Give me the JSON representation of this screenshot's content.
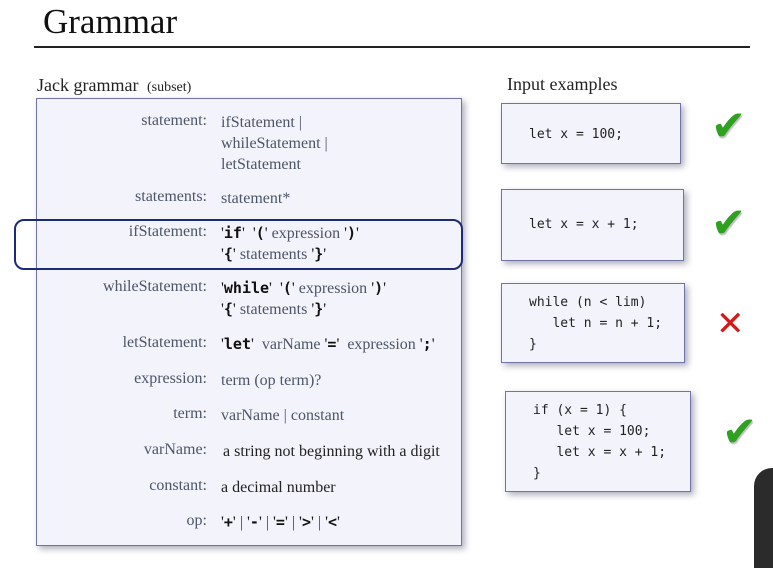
{
  "title": "Grammar",
  "grammar": {
    "heading": "Jack grammar",
    "heading_sub": "(subset)",
    "rules": [
      {
        "label": "statement:",
        "lines": [
          "ifStatement |",
          "whileStatement |",
          "letStatement"
        ]
      },
      {
        "label": "statements:",
        "text": "statement*"
      },
      {
        "label": "ifStatement:",
        "kw_if": "if",
        "open_paren": "(",
        "expression": "expression",
        "close_paren": ")",
        "open_brace": "{",
        "statements": "statements",
        "close_brace": "}"
      },
      {
        "label": "whileStatement:",
        "kw_while": "while",
        "open_paren": "(",
        "expression": "expression",
        "close_paren": ")",
        "open_brace": "{",
        "statements": "statements",
        "close_brace": "}"
      },
      {
        "label": "letStatement:",
        "kw_let": "let",
        "varname": "varName",
        "eq": "=",
        "expression": "expression",
        "semi": ";"
      },
      {
        "label": "expression:",
        "text": "term (op term)?"
      },
      {
        "label": "term:",
        "text": "varName | constant"
      },
      {
        "label": "varName:",
        "text": "a string not beginning with a digit"
      },
      {
        "label": "constant:",
        "text": "a decimal number"
      },
      {
        "label": "op:",
        "ops": [
          "+",
          "-",
          "=",
          ">",
          "<"
        ]
      }
    ]
  },
  "examples": {
    "heading": "Input examples",
    "items": [
      {
        "code": "let x = 100;",
        "result": "valid"
      },
      {
        "code": "let x = x + 1;",
        "result": "valid"
      },
      {
        "code": "while (n < lim)\n   let n = n + 1;\n}",
        "result": "invalid"
      },
      {
        "code": "if (x = 1) {\n   let x = 100;\n   let x = x + 1;\n}",
        "result": "valid"
      }
    ],
    "check_glyph": "✔",
    "cross_glyph": "✕",
    "colors": {
      "check": "#2fa01f",
      "cross": "#d11a1a",
      "highlight": "#1c2a78"
    }
  }
}
